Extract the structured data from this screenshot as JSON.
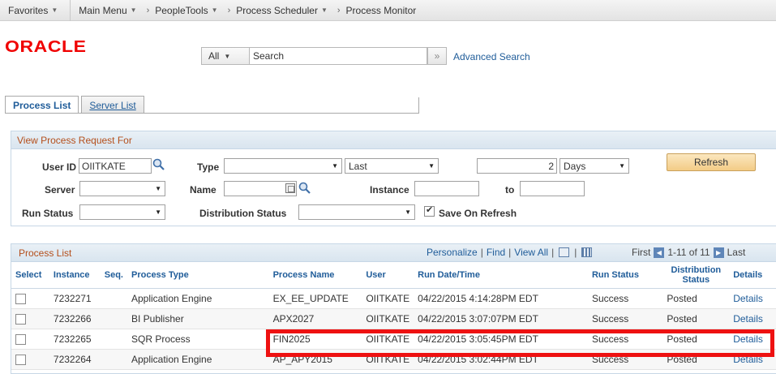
{
  "breadcrumb": {
    "favorites": "Favorites",
    "main_menu": "Main Menu",
    "peopletools": "PeopleTools",
    "process_scheduler": "Process Scheduler",
    "process_monitor": "Process Monitor",
    "caret": "▼",
    "arrow": "›"
  },
  "header": {
    "logo": "ORACLE",
    "search_scope": "All",
    "search_value": "Search",
    "search_go": "»",
    "advanced_search": "Advanced Search"
  },
  "tabs": {
    "process_list": "Process List",
    "server_list": "Server List"
  },
  "criteria": {
    "title": "View Process Request For",
    "user_id_label": "User ID",
    "user_id_value": "OIITKATE",
    "type_label": "Type",
    "type_value": "",
    "last_value": "Last",
    "days_count": "2",
    "days_unit": "Days",
    "refresh_label": "Refresh",
    "server_label": "Server",
    "server_value": "",
    "name_label": "Name",
    "name_value": "",
    "instance_label": "Instance",
    "instance_from": "",
    "to_label": "to",
    "instance_to": "",
    "run_status_label": "Run Status",
    "run_status_value": "",
    "distribution_status_label": "Distribution Status",
    "distribution_status_value": "",
    "save_on_refresh_label": "Save On Refresh",
    "save_on_refresh_checked": true
  },
  "grid": {
    "title": "Process List",
    "personalize": "Personalize",
    "find": "Find",
    "view_all": "View All",
    "sep": "|",
    "first": "First",
    "range": "1-11 of 11",
    "last": "Last",
    "columns": {
      "select": "Select",
      "instance": "Instance",
      "seq": "Seq.",
      "process_type": "Process Type",
      "process_name": "Process Name",
      "user": "User",
      "run_datetime": "Run Date/Time",
      "run_status": "Run Status",
      "distribution_status": "Distribution Status",
      "details": "Details"
    },
    "rows": [
      {
        "instance": "7232271",
        "seq": "",
        "process_type": "Application Engine",
        "process_name": "EX_EE_UPDATE",
        "user": "OIITKATE",
        "run_datetime": "04/22/2015  4:14:28PM EDT",
        "run_status": "Success",
        "distribution_status": "Posted",
        "details": "Details"
      },
      {
        "instance": "7232266",
        "seq": "",
        "process_type": "BI Publisher",
        "process_name": "APX2027",
        "user": "OIITKATE",
        "run_datetime": "04/22/2015  3:07:07PM EDT",
        "run_status": "Success",
        "distribution_status": "Posted",
        "details": "Details"
      },
      {
        "instance": "7232265",
        "seq": "",
        "process_type": "SQR Process",
        "process_name": "FIN2025",
        "user": "OIITKATE",
        "run_datetime": "04/22/2015  3:05:45PM EDT",
        "run_status": "Success",
        "distribution_status": "Posted",
        "details": "Details"
      },
      {
        "instance": "7232264",
        "seq": "",
        "process_type": "Application Engine",
        "process_name": "AP_APY2015",
        "user": "OIITKATE",
        "run_datetime": "04/22/2015  3:02:44PM EDT",
        "run_status": "Success",
        "distribution_status": "Posted",
        "details": "Details"
      }
    ]
  },
  "colors": {
    "link": "#1f5c99",
    "section_title": "#b44f1c",
    "highlight": "#ee1111",
    "logo": "#f00000"
  }
}
